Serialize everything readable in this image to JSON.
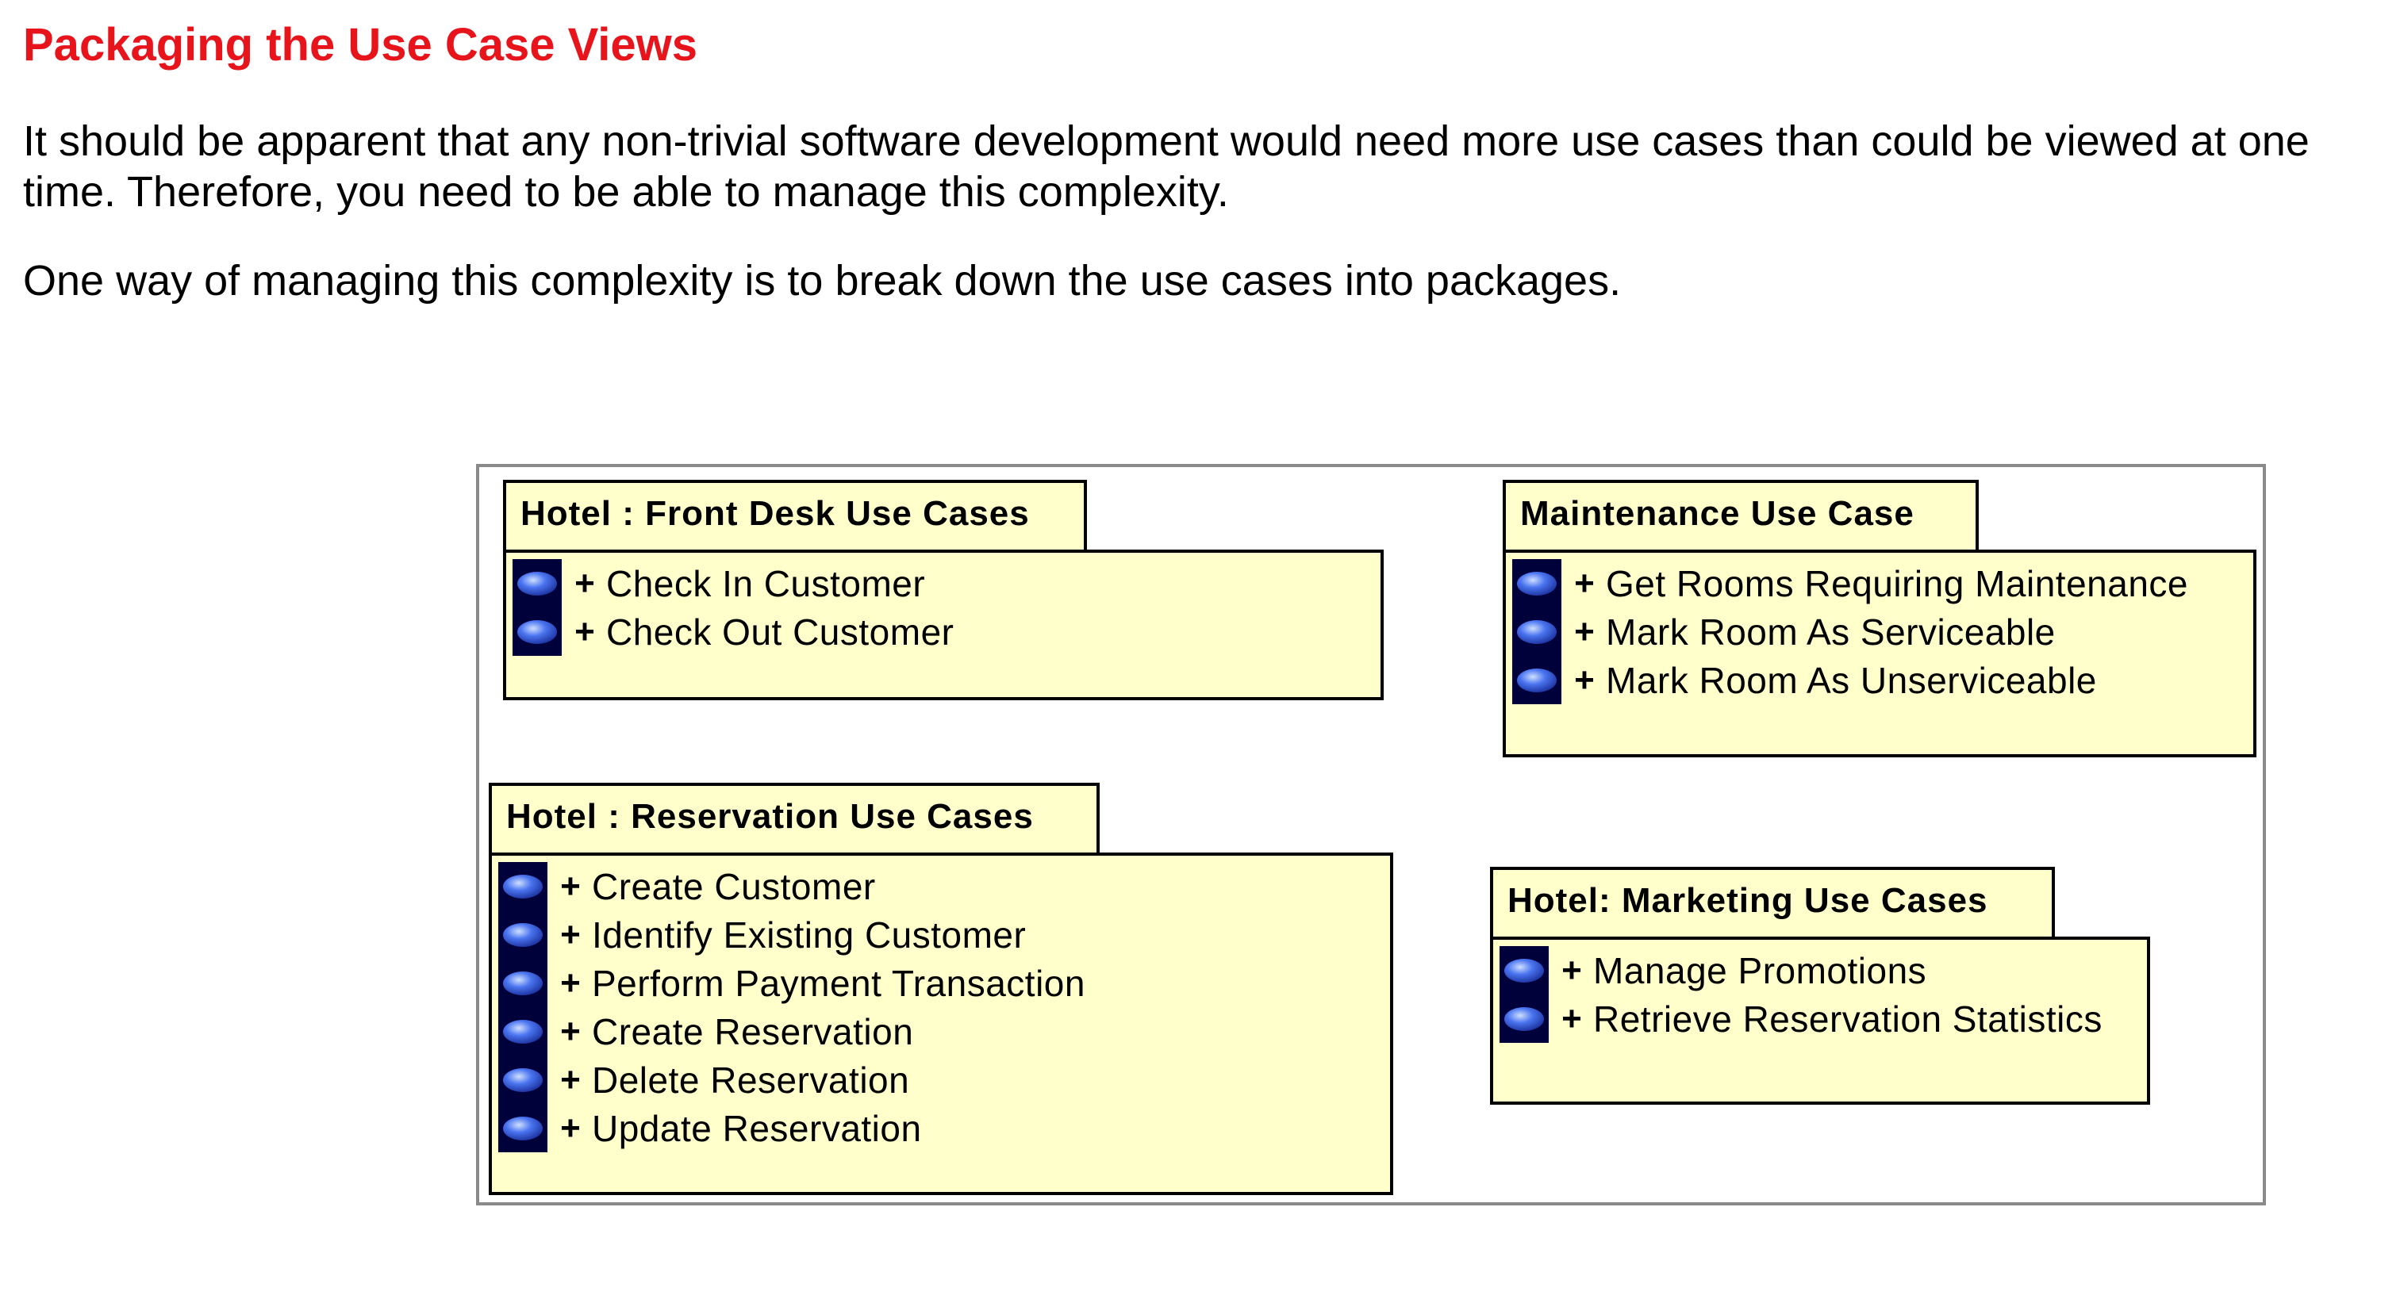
{
  "title": "Packaging the Use Case Views",
  "paragraphs": [
    "It should be apparent that any non-trivial software development would need more use cases than could be viewed at one time. Therefore, you need to be able to manage this complexity.",
    "One way of managing this complexity is to break down the use cases into packages."
  ],
  "colors": {
    "title": "#e8141c",
    "package_fill": "#ffffcc",
    "icon_bg": "#00003a",
    "icon_blue": "#4a74f0"
  },
  "packages": {
    "front_desk": {
      "name": "Hotel : Front Desk Use Cases",
      "items": [
        {
          "vis": "+",
          "label": "Check In Customer"
        },
        {
          "vis": "+",
          "label": "Check Out Customer"
        }
      ]
    },
    "maintenance": {
      "name": "Maintenance Use Case",
      "items": [
        {
          "vis": "+",
          "label": "Get Rooms Requiring Maintenance"
        },
        {
          "vis": "+",
          "label": "Mark Room As Serviceable"
        },
        {
          "vis": "+",
          "label": "Mark Room As Unserviceable"
        }
      ]
    },
    "reservation": {
      "name": "Hotel : Reservation Use Cases",
      "items": [
        {
          "vis": "+",
          "label": "Create Customer"
        },
        {
          "vis": "+",
          "label": "Identify Existing Customer"
        },
        {
          "vis": "+",
          "label": "Perform Payment Transaction"
        },
        {
          "vis": "+",
          "label": "Create Reservation"
        },
        {
          "vis": "+",
          "label": "Delete Reservation"
        },
        {
          "vis": "+",
          "label": "Update Reservation"
        }
      ]
    },
    "marketing": {
      "name": "Hotel: Marketing Use Cases",
      "items": [
        {
          "vis": "+",
          "label": "Manage Promotions"
        },
        {
          "vis": "+",
          "label": "Retrieve Reservation Statistics"
        }
      ]
    }
  }
}
